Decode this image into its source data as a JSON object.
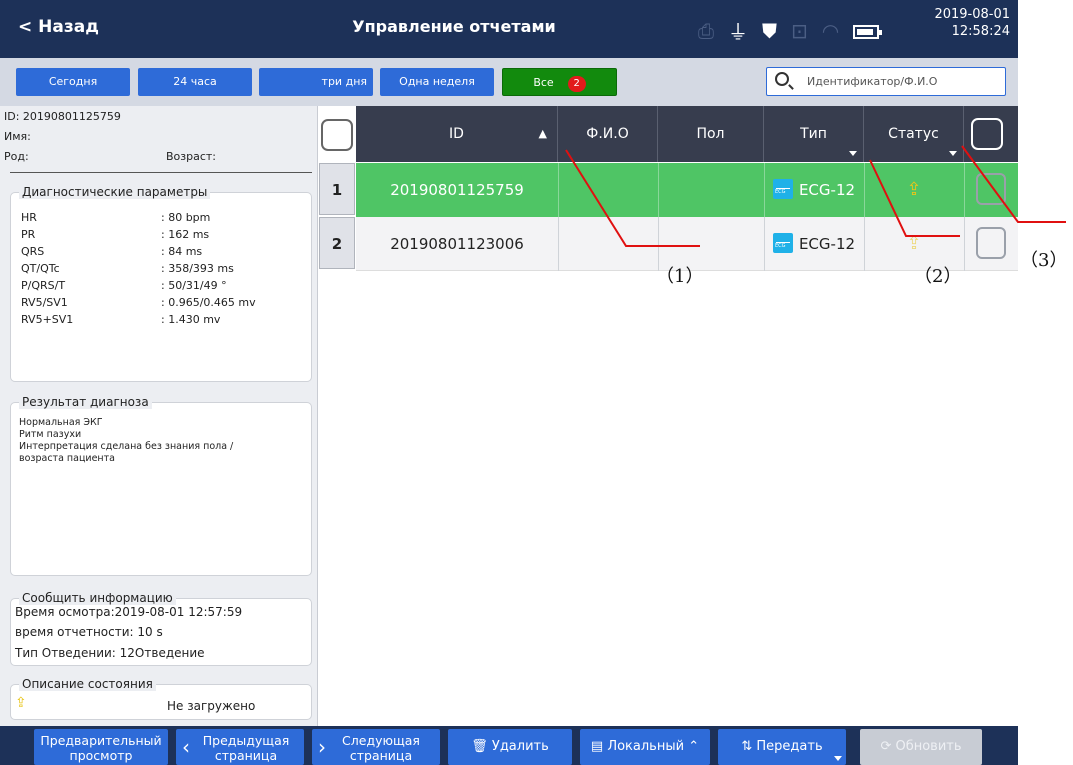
{
  "topbar": {
    "back_label": "< Назад",
    "title": "Управление отчетами",
    "date": "2019-08-01",
    "time": "12:58:24"
  },
  "filters": {
    "today": "Сегодня",
    "h24": "24 часа",
    "three_days": "три дня",
    "one_week": "Одна неделя",
    "all": "Все",
    "all_count": "2"
  },
  "search": {
    "placeholder": "Идентификатор/Ф.И.О"
  },
  "patient": {
    "id_line": "ID: 20190801125759",
    "name_label": "Имя:",
    "gender_label": "Род:",
    "age_label": "Возраст:"
  },
  "diag_params": {
    "title": "Диагностические параметры",
    "rows": [
      {
        "k": "HR",
        "v": ": 80 bpm"
      },
      {
        "k": "PR",
        "v": ": 162 ms"
      },
      {
        "k": "QRS",
        "v": ": 84 ms"
      },
      {
        "k": "QT/QTc",
        "v": ": 358/393 ms"
      },
      {
        "k": "P/QRS/T",
        "v": ": 50/31/49 °"
      },
      {
        "k": "RV5/SV1",
        "v": ": 0.965/0.465 mv"
      },
      {
        "k": "RV5+SV1",
        "v": ": 1.430 mv"
      }
    ]
  },
  "diag_result": {
    "title": "Результат диагноза",
    "lines": [
      "Нормальная ЭКГ",
      "Ритм пазухи",
      "Интерпретация сделана без знания пола /",
      "возраста пациента"
    ]
  },
  "report_info": {
    "title": "Сообщить информацию",
    "exam_time": "Время осмотра:2019-08-01 12:57:59",
    "report_time": "время отчетности: 10 s",
    "lead_type": "Тип Отведении: 12Отведение"
  },
  "state": {
    "title": "Описание состояния",
    "value": "Не загружено"
  },
  "table": {
    "headers": {
      "id": "ID",
      "name": "Ф.И.О",
      "gender": "Пол",
      "type": "Тип",
      "status": "Статус"
    },
    "rows": [
      {
        "num": "1",
        "id": "20190801125759",
        "name": "",
        "gender": "",
        "type": "ECG-12"
      },
      {
        "num": "2",
        "id": "20190801123006",
        "name": "",
        "gender": "",
        "type": "ECG-12"
      }
    ]
  },
  "bottombar": {
    "preview_l1": "Предварительный",
    "preview_l2": "просмотр",
    "prev_l1": "Предыдущая",
    "prev_l2": "страница",
    "next_l1": "Следующая",
    "next_l2": "страница",
    "delete": "Удалить",
    "local": "Локальный",
    "transfer": "Передать",
    "refresh": "Обновить"
  },
  "annotations": {
    "a1": "（1）",
    "a2": "（2）",
    "a3": "（3）"
  },
  "colors": {
    "header_bg": "#1d3158",
    "button_blue": "#2e6bd8",
    "all_green": "#128a0d",
    "selected_row": "#4fc565",
    "upload_yellow": "#e8c51a"
  }
}
